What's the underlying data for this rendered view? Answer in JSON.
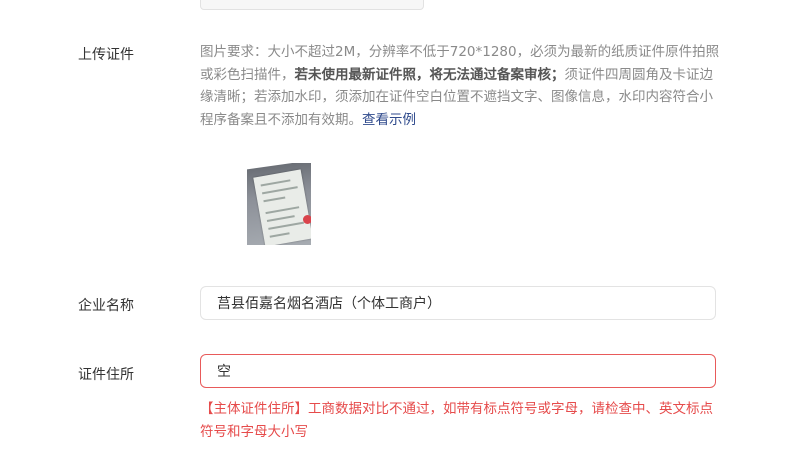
{
  "upload": {
    "label": "上传证件",
    "desc_normal_1": "图片要求：大小不超过2M，分辨率不低于720*1280，必须为最新的纸质证件原件拍照或彩色扫描件，",
    "desc_bold": "若未使用最新证件照，将无法通过备案审核；",
    "desc_normal_2": "须证件四周圆角及卡证边缘清晰；若添加水印，须添加在证件空白位置不遮挡文字、图像信息，水印内容符合小程序备案且不添加有效期。",
    "view_example": "查看示例"
  },
  "company": {
    "label": "企业名称",
    "value": "莒县佰嘉名烟名酒店（个体工商户）"
  },
  "address": {
    "label": "证件住所",
    "value": "空",
    "error": "【主体证件住所】工商数据对比不通过，如带有标点符号或字母，请检查中、英文标点符号和字母大小写"
  }
}
